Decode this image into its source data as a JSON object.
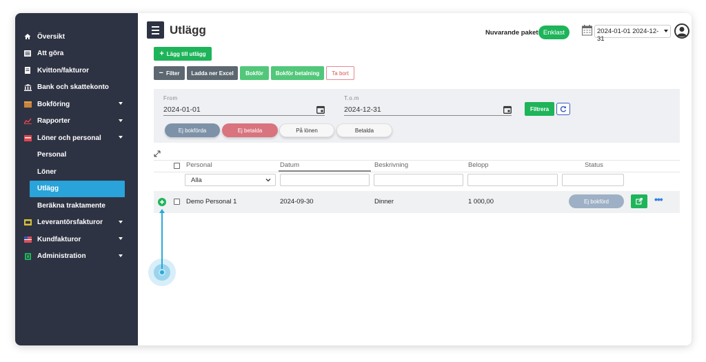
{
  "sidebar": {
    "items": [
      {
        "label": "Översikt",
        "icon": "home-icon"
      },
      {
        "label": "Att göra",
        "icon": "list-icon"
      },
      {
        "label": "Kvitton/fakturor",
        "icon": "receipt-icon"
      },
      {
        "label": "Bank och skattekonto",
        "icon": "bank-icon"
      },
      {
        "label": "Bokföring",
        "icon": "book-icon"
      },
      {
        "label": "Rapporter",
        "icon": "chart-icon"
      },
      {
        "label": "Löner och personal",
        "icon": "payroll-icon"
      },
      {
        "label": "Personal"
      },
      {
        "label": "Löner"
      },
      {
        "label": "Utlägg"
      },
      {
        "label": "Beräkna traktamente"
      },
      {
        "label": "Leverantörsfakturor",
        "icon": "supplier-icon"
      },
      {
        "label": "Kundfakturor",
        "icon": "customer-icon"
      },
      {
        "label": "Administration",
        "icon": "admin-icon"
      }
    ]
  },
  "header": {
    "title": "Utlägg",
    "package_label": "Nuvarande paket",
    "package_value": "Enklast",
    "date_range": "2024-01-01 2024-12-31"
  },
  "toolbar": {
    "add_label": "Lägg till utlägg",
    "filter_label": "Filter",
    "excel_label": "Ladda ner Excel",
    "book_label": "Bokför",
    "book_payment_label": "Bokför betalning",
    "delete_label": "Ta bort"
  },
  "filters": {
    "from_label": "From",
    "from_value": "2024-01-01",
    "to_label": "T.o.m",
    "to_value": "2024-12-31",
    "apply_label": "Filtrera",
    "pills": [
      "Ej bokförda",
      "Ej betalda",
      "På lönen",
      "Betalda"
    ]
  },
  "table": {
    "headers": [
      "Personal",
      "Datum",
      "Beskrivning",
      "Belopp",
      "Status"
    ],
    "personal_filter": "Alla",
    "rows": [
      {
        "personal": "Demo Personal 1",
        "datum": "2024-09-30",
        "beskrivning": "Dinner",
        "belopp": "1 000,00",
        "status": "Ej bokförd"
      }
    ]
  },
  "colors": {
    "sidebar": "#2e3343",
    "active": "#29a3d9",
    "green": "#1eb45a",
    "accent_blue": "#2f7de1"
  }
}
